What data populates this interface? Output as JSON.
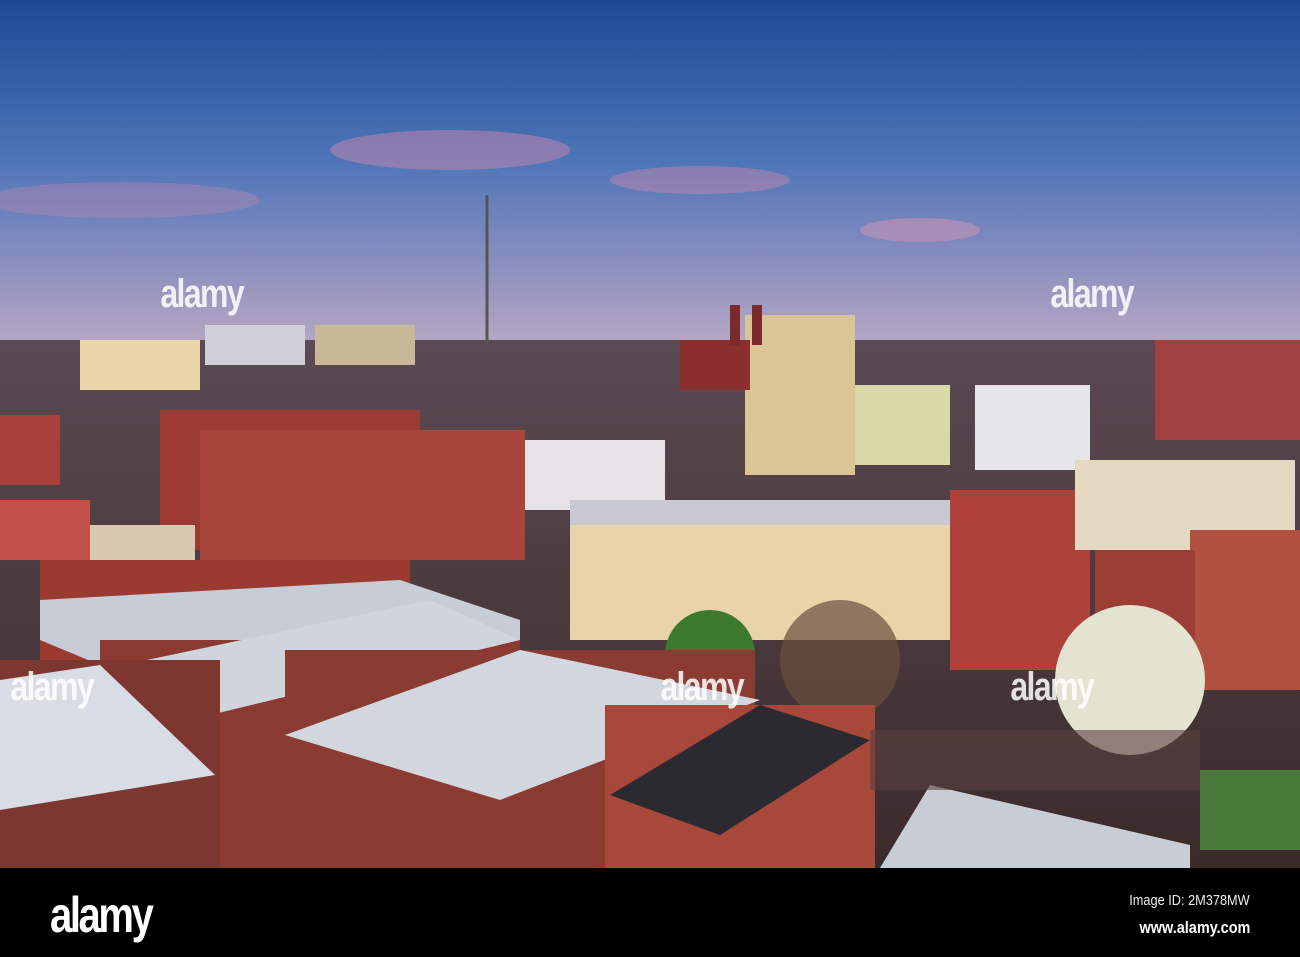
{
  "watermark": {
    "text": "alamy",
    "mark": "a"
  },
  "footer": {
    "logo": "alamy",
    "image_id": "Image ID: 2M378MW",
    "site": "www.alamy.com"
  }
}
